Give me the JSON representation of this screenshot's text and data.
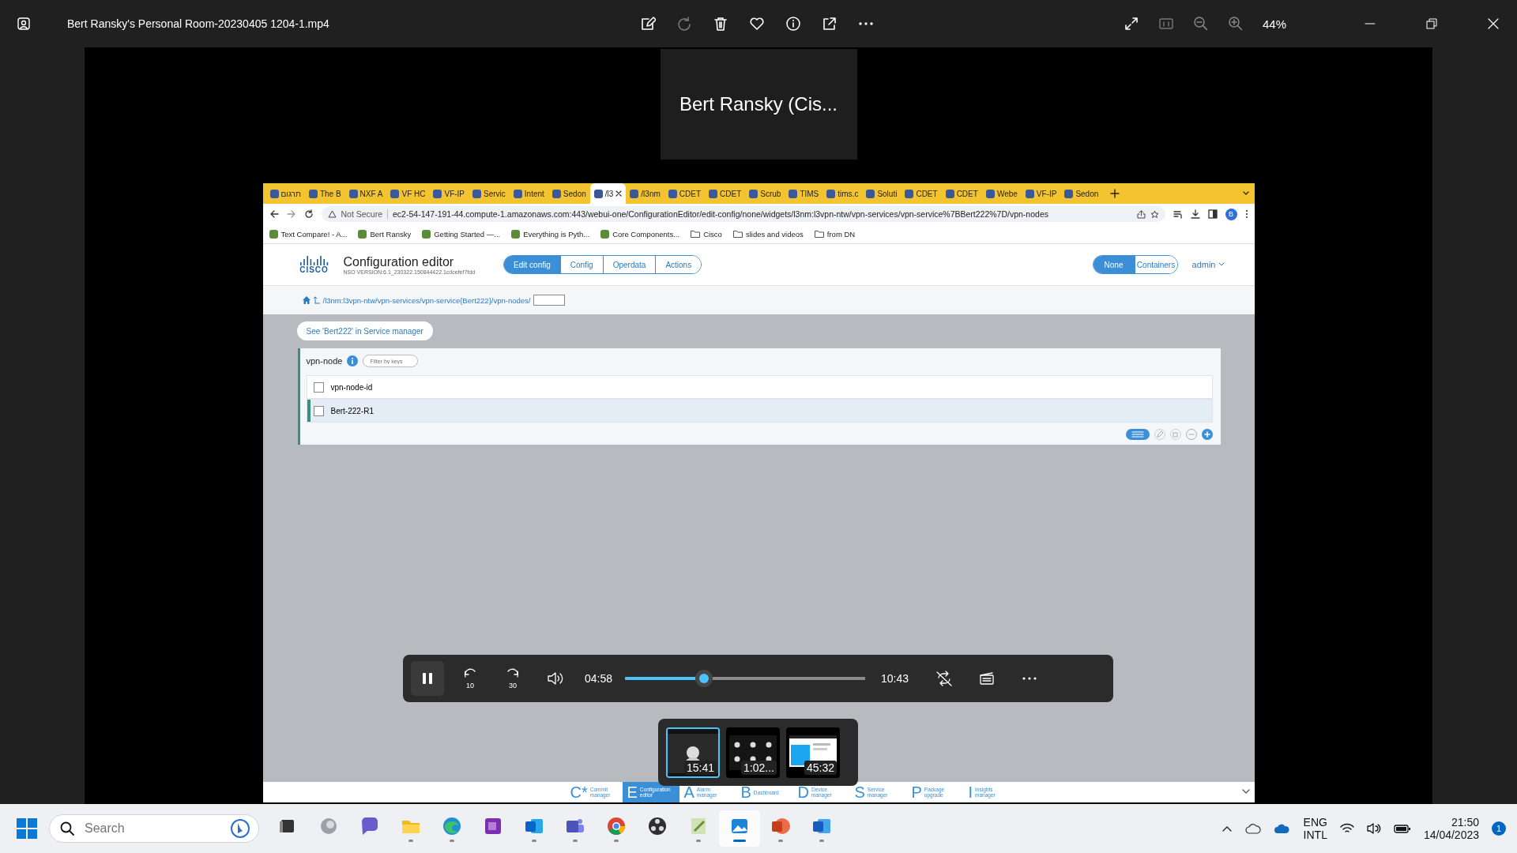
{
  "window": {
    "title": "Bert Ransky's Personal Room-20230405 1204-1.mp4",
    "zoom": "44%"
  },
  "participant": {
    "name": "Bert Ransky (Cis..."
  },
  "browser": {
    "tabs": [
      {
        "label": "תרגום",
        "selected": false
      },
      {
        "label": "The B",
        "selected": false
      },
      {
        "label": "NXF A",
        "selected": false
      },
      {
        "label": "VF HC",
        "selected": false
      },
      {
        "label": "VF-IP",
        "selected": false
      },
      {
        "label": "Servic",
        "selected": false
      },
      {
        "label": "Intent",
        "selected": false
      },
      {
        "label": "Sedon",
        "selected": false
      },
      {
        "label": "/l3",
        "selected": true
      },
      {
        "label": "/l3nm",
        "selected": false
      },
      {
        "label": "CDET",
        "selected": false
      },
      {
        "label": "CDET",
        "selected": false
      },
      {
        "label": "Scrub",
        "selected": false
      },
      {
        "label": "TIMS",
        "selected": false
      },
      {
        "label": "tims.c",
        "selected": false
      },
      {
        "label": "Soluti",
        "selected": false
      },
      {
        "label": "CDET",
        "selected": false
      },
      {
        "label": "CDET",
        "selected": false
      },
      {
        "label": "Webe",
        "selected": false
      },
      {
        "label": "VF-IP",
        "selected": false
      },
      {
        "label": "Sedon",
        "selected": false
      }
    ],
    "security": "Not Secure",
    "url": "ec2-54-147-191-44.compute-1.amazonaws.com:443/webui-one/ConfigurationEditor/edit-config/none/widgets/l3nm:l3vpn-ntw/vpn-services/vpn-service%7BBert222%7D/vpn-nodes",
    "profile": "B",
    "bookmarks": [
      {
        "label": "Text Compare! - A...",
        "kind": "link"
      },
      {
        "label": "Bert Ransky",
        "kind": "link"
      },
      {
        "label": "Getting Started —...",
        "kind": "link"
      },
      {
        "label": "Everything is Pyth...",
        "kind": "link"
      },
      {
        "label": "Core Components...",
        "kind": "link"
      },
      {
        "label": "Cisco",
        "kind": "folder"
      },
      {
        "label": "slides and videos",
        "kind": "folder"
      },
      {
        "label": "from DN",
        "kind": "folder"
      }
    ]
  },
  "app": {
    "logo": "CISCO",
    "title": "Configuration editor",
    "version": "NSO VERSION:6.1_230322.150844422.1cdcefef7fdd",
    "mode_tabs": [
      {
        "label": "Edit config",
        "selected": true
      },
      {
        "label": "Config",
        "selected": false
      },
      {
        "label": "Operdata",
        "selected": false
      },
      {
        "label": "Actions",
        "selected": false
      }
    ],
    "view_toggle": [
      {
        "label": "None",
        "selected": true
      },
      {
        "label": "Containers",
        "selected": false
      }
    ],
    "user": "admin",
    "breadcrumb": "/l3nm:l3vpn-ntw/vpn-services/vpn-service{Bert222}/vpn-nodes/",
    "service_link": "See 'Bert222' in Service manager",
    "list": {
      "title": "vpn-node",
      "filter_placeholder": "Filter by keys",
      "column": "vpn-node-id",
      "header_checked": false,
      "rows": [
        {
          "value": "Bert-222-R1",
          "checked": false,
          "selected": true
        }
      ]
    },
    "bottom_nav": [
      {
        "letter": "C*",
        "label": "Commit manager",
        "selected": false
      },
      {
        "letter": "E",
        "label": "Configuration editor",
        "selected": true
      },
      {
        "letter": "A",
        "label": "Alarm manager",
        "selected": false
      },
      {
        "letter": "B",
        "label": "Dashboard",
        "selected": false
      },
      {
        "letter": "D",
        "label": "Device manager",
        "selected": false
      },
      {
        "letter": "S",
        "label": "Service manager",
        "selected": false
      },
      {
        "letter": "P",
        "label": "Package upgrade",
        "selected": false
      },
      {
        "letter": "I",
        "label": "Insights manager",
        "selected": false
      }
    ]
  },
  "player": {
    "position": "04:58",
    "duration": "10:43",
    "level": 0.33,
    "skip_back": "10",
    "skip_forward": "30",
    "chapters": [
      {
        "time": "15:41",
        "selected": true
      },
      {
        "time": "1:02...",
        "selected": false
      },
      {
        "time": "45:32",
        "selected": false
      }
    ]
  },
  "taskbar": {
    "search_placeholder": "Search",
    "apps": [
      {
        "kind": "task-view",
        "running": false,
        "selected": false
      },
      {
        "kind": "copilot",
        "running": false,
        "selected": false
      },
      {
        "kind": "chat",
        "running": false,
        "selected": false
      },
      {
        "kind": "folder",
        "running": true,
        "selected": false
      },
      {
        "kind": "edge",
        "running": true,
        "selected": false
      },
      {
        "kind": "onenote",
        "running": false,
        "selected": false
      },
      {
        "kind": "outlook",
        "running": true,
        "selected": false
      },
      {
        "kind": "teams",
        "running": true,
        "selected": false
      },
      {
        "kind": "chrome",
        "running": true,
        "selected": false
      },
      {
        "kind": "obs",
        "running": false,
        "selected": false
      },
      {
        "kind": "notepad",
        "running": true,
        "selected": false
      },
      {
        "kind": "photos",
        "running": true,
        "selected": true
      },
      {
        "kind": "powerpoint",
        "running": true,
        "selected": false
      },
      {
        "kind": "word",
        "running": true,
        "selected": false
      }
    ],
    "language": "ENG",
    "layout": "INTL",
    "time": "21:50",
    "date": "14/04/2023",
    "notifications": "1"
  }
}
